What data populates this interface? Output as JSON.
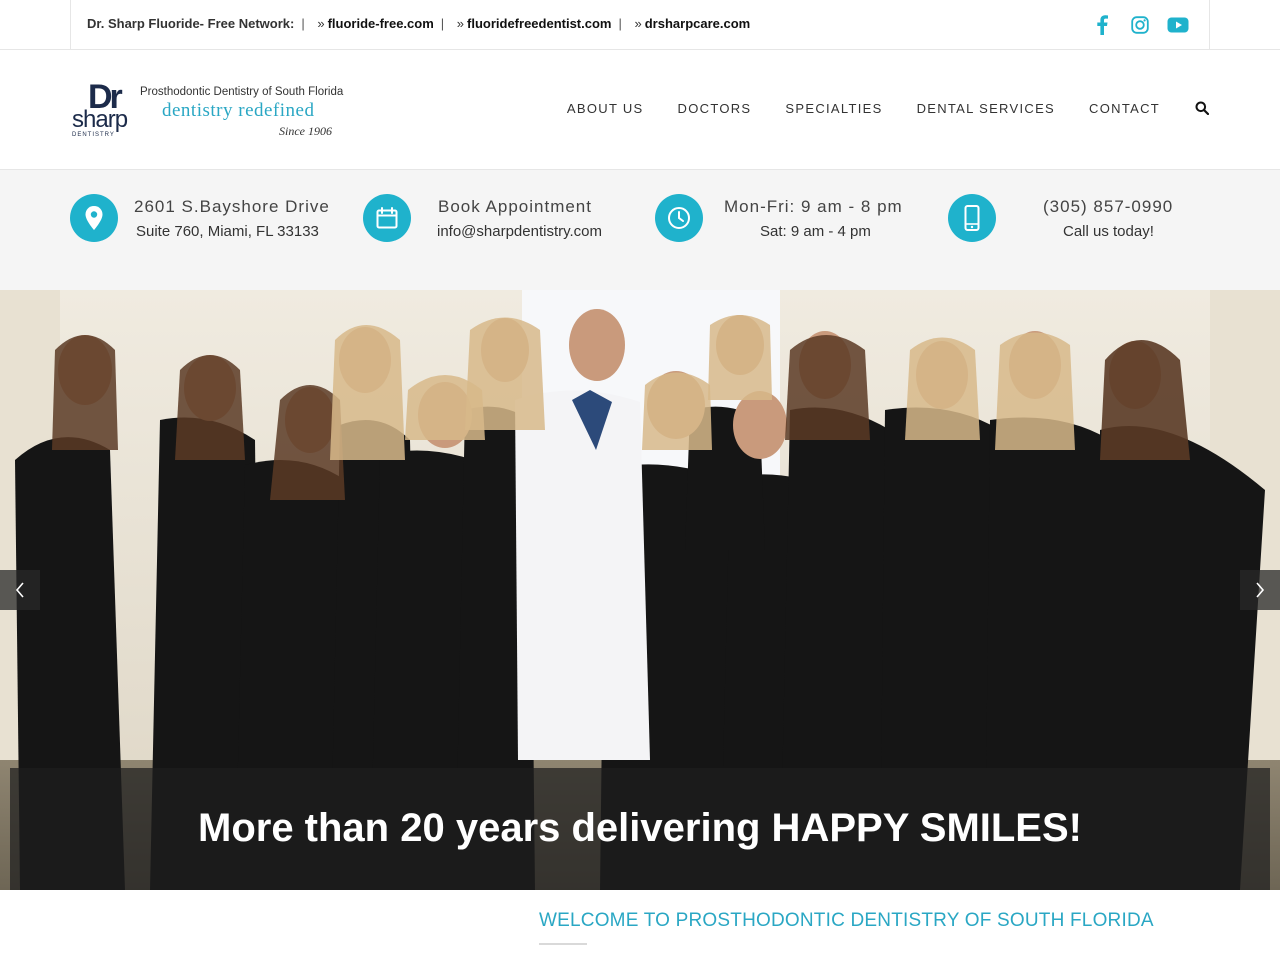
{
  "topbar": {
    "network_label": "Dr. Sharp Fluoride- Free Network:",
    "separator": "|",
    "links": [
      {
        "prefix": "»",
        "label": "fluoride-free.com"
      },
      {
        "prefix": "»",
        "label": "fluoridefreedentist.com"
      },
      {
        "prefix": "»",
        "label": "drsharpcare.com"
      }
    ],
    "social": [
      "facebook-icon",
      "instagram-icon",
      "youtube-icon"
    ],
    "social_color": "#1fb2cc"
  },
  "logo": {
    "mark_dr": "Dr",
    "mark_sharp": "sharp",
    "mark_dentistry": "DENTISTRY",
    "tagline_top": "Prosthodontic Dentistry of South Florida",
    "tagline_main": "dentistry redefined",
    "tagline_since": "Since 1906"
  },
  "nav": {
    "items": [
      "ABOUT US",
      "DOCTORS",
      "SPECIALTIES",
      "DENTAL SERVICES",
      "CONTACT"
    ],
    "search_icon": "search-icon"
  },
  "info": [
    {
      "icon": "location-pin-icon",
      "line1": "2601 S.Bayshore Drive",
      "line2": "Suite 760, Miami, FL 33133"
    },
    {
      "icon": "calendar-icon",
      "line1": "Book Appointment",
      "line2": "info@sharpdentistry.com"
    },
    {
      "icon": "clock-icon",
      "line1": "Mon-Fri: 9 am - 8 pm",
      "line2": "Sat: 9 am - 4 pm"
    },
    {
      "icon": "phone-icon",
      "line1": "(305) 857-0990",
      "line2": "Call us today!"
    }
  ],
  "accent_color": "#1fb2cc",
  "slider": {
    "caption": "More than 20 years delivering HAPPY SMILES!",
    "prev_icon": "chevron-left-icon",
    "next_icon": "chevron-right-icon"
  },
  "welcome": {
    "heading": "WELCOME TO PROSTHODONTIC DENTISTRY OF SOUTH FLORIDA"
  }
}
